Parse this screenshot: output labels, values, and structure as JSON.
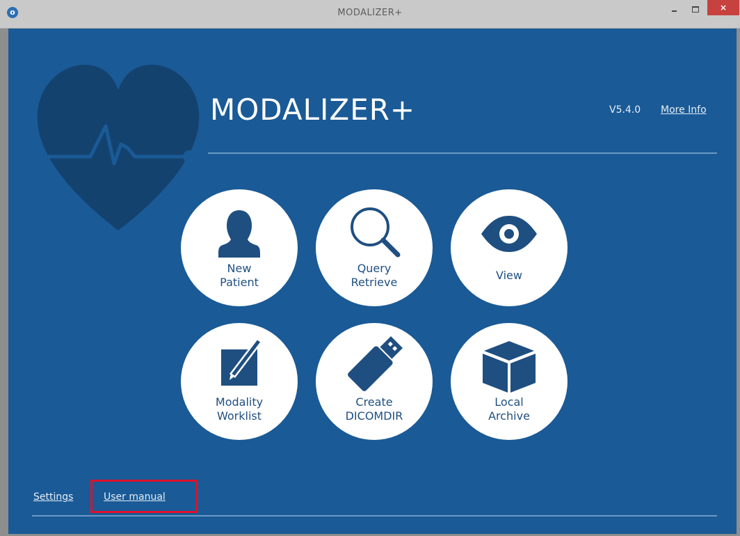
{
  "window": {
    "title": "MODALIZER+",
    "close_glyph": "×",
    "app_icon_glyph": "o"
  },
  "header": {
    "app_name": "MODALIZER+",
    "version": "V5.4.0",
    "more_info": "More Info"
  },
  "tiles": [
    {
      "line1": "New",
      "line2": "Patient",
      "icon": "person-icon"
    },
    {
      "line1": "Query",
      "line2": "Retrieve",
      "icon": "magnifier-icon"
    },
    {
      "line1": "View",
      "line2": "",
      "icon": "eye-icon"
    },
    {
      "line1": "Modality",
      "line2": "Worklist",
      "icon": "edit-icon"
    },
    {
      "line1": "Create",
      "line2": "DICOMDIR",
      "icon": "usb-drive-icon"
    },
    {
      "line1": "Local",
      "line2": "Archive",
      "icon": "cube-icon"
    }
  ],
  "footer": {
    "settings": "Settings",
    "user_manual": "User manual"
  },
  "colors": {
    "background": "#1a5a96",
    "heart": "#14426f",
    "icon": "#1f4f80",
    "highlight": "#e0102a"
  }
}
